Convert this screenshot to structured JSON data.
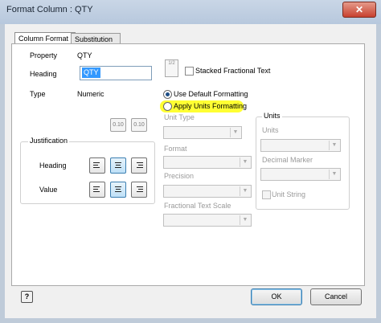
{
  "window": {
    "title": "Format Column : QTY",
    "close_glyph": "✕"
  },
  "tabs": [
    {
      "label": "Column Format"
    },
    {
      "label": "Substitution"
    }
  ],
  "property": {
    "label": "Property",
    "value": "QTY"
  },
  "heading": {
    "label": "Heading",
    "value": "QTY"
  },
  "type": {
    "label": "Type",
    "value": "Numeric"
  },
  "stacked": {
    "label": "Stacked Fractional Text",
    "icon_text": "1/2"
  },
  "precision_buttons": [
    "0.10",
    "0.10"
  ],
  "justification": {
    "title": "Justification",
    "heading_label": "Heading",
    "value_label": "Value"
  },
  "formatting": {
    "default_label": "Use Default Formatting",
    "units_label": "Apply Units Formatting",
    "selected": "default",
    "highlight_color": "#ffff33"
  },
  "units_options": {
    "unit_type": "Unit Type",
    "format": "Format",
    "precision": "Precision",
    "fractional_scale": "Fractional Text Scale",
    "units_group": "Units",
    "units": "Units",
    "decimal_marker": "Decimal Marker",
    "unit_string": "Unit String"
  },
  "buttons": {
    "ok": "OK",
    "cancel": "Cancel",
    "help": "?"
  }
}
